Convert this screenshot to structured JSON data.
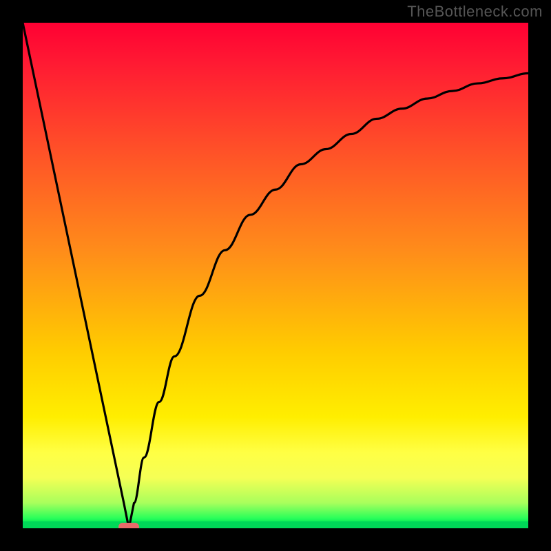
{
  "watermark": "TheBottleneck.com",
  "colors": {
    "frame": "#000000",
    "curve": "#000000",
    "marker": "#e96a6a",
    "gradient_top": "#ff0033",
    "gradient_mid": "#ffcc00",
    "gradient_bottom": "#00d858"
  },
  "chart_data": {
    "type": "line",
    "title": "",
    "xlabel": "",
    "ylabel": "",
    "xlim": [
      0,
      100
    ],
    "ylim": [
      0,
      100
    ],
    "description": "V-shaped bottleneck curve on a vertical rainbow gradient. Curve starts near top-left, descends steeply and linearly to a minimum near x≈21 at y≈0, then rises with a decelerating (log-like) curve toward the upper-right, asymptotically approaching y≈90. A small rounded coral marker sits at the minimum on the green baseline.",
    "series": [
      {
        "name": "bottleneck-curve",
        "x": [
          0,
          4,
          8,
          12,
          16,
          20,
          21,
          22,
          24,
          27,
          30,
          35,
          40,
          45,
          50,
          55,
          60,
          65,
          70,
          75,
          80,
          85,
          90,
          95,
          100
        ],
        "y": [
          100,
          81,
          62,
          43,
          24,
          5,
          0,
          5,
          14,
          25,
          34,
          46,
          55,
          62,
          67,
          72,
          75,
          78,
          81,
          83,
          85,
          86.5,
          88,
          89,
          90
        ]
      }
    ],
    "marker": {
      "x": 21,
      "y": 0
    },
    "grid": false,
    "gradient_stops": [
      {
        "pos": 0,
        "color": "#ff0033"
      },
      {
        "pos": 25,
        "color": "#ff5a28"
      },
      {
        "pos": 50,
        "color": "#ffb300"
      },
      {
        "pos": 75,
        "color": "#ffee00"
      },
      {
        "pos": 95,
        "color": "#a8ff5c"
      },
      {
        "pos": 100,
        "color": "#00d858"
      }
    ]
  }
}
